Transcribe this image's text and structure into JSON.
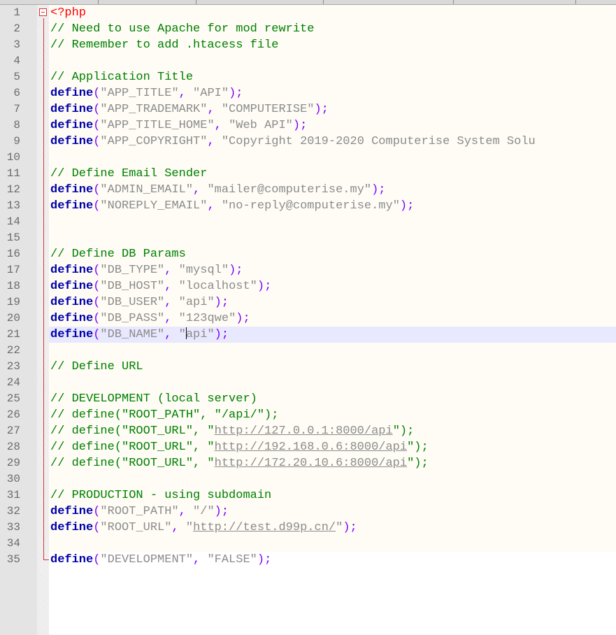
{
  "editor": {
    "language": "PHP",
    "caret_line": 21,
    "lines": [
      {
        "n": "1",
        "tokens": [
          {
            "t": "php",
            "v": "<?php"
          }
        ]
      },
      {
        "n": "2",
        "tokens": [
          {
            "t": "cmt",
            "v": "// Need to use Apache for mod rewrite"
          }
        ]
      },
      {
        "n": "3",
        "tokens": [
          {
            "t": "cmt",
            "v": "// Remember to add .htacess file"
          }
        ]
      },
      {
        "n": "4",
        "tokens": []
      },
      {
        "n": "5",
        "tokens": [
          {
            "t": "cmt",
            "v": "// Application Title"
          }
        ]
      },
      {
        "n": "6",
        "tokens": [
          {
            "t": "kw",
            "v": "define"
          },
          {
            "t": "op",
            "v": "("
          },
          {
            "t": "str",
            "v": "\"APP_TITLE\""
          },
          {
            "t": "op",
            "v": ", "
          },
          {
            "t": "str",
            "v": "\"API\""
          },
          {
            "t": "op",
            "v": ");"
          }
        ]
      },
      {
        "n": "7",
        "tokens": [
          {
            "t": "kw",
            "v": "define"
          },
          {
            "t": "op",
            "v": "("
          },
          {
            "t": "str",
            "v": "\"APP_TRADEMARK\""
          },
          {
            "t": "op",
            "v": ", "
          },
          {
            "t": "str",
            "v": "\"COMPUTERISE\""
          },
          {
            "t": "op",
            "v": ");"
          }
        ]
      },
      {
        "n": "8",
        "tokens": [
          {
            "t": "kw",
            "v": "define"
          },
          {
            "t": "op",
            "v": "("
          },
          {
            "t": "str",
            "v": "\"APP_TITLE_HOME\""
          },
          {
            "t": "op",
            "v": ", "
          },
          {
            "t": "str",
            "v": "\"Web API\""
          },
          {
            "t": "op",
            "v": ");"
          }
        ]
      },
      {
        "n": "9",
        "tokens": [
          {
            "t": "kw",
            "v": "define"
          },
          {
            "t": "op",
            "v": "("
          },
          {
            "t": "str",
            "v": "\"APP_COPYRIGHT\""
          },
          {
            "t": "op",
            "v": ", "
          },
          {
            "t": "str",
            "v": "\"Copyright 2019-2020 Computerise System Solu"
          }
        ]
      },
      {
        "n": "10",
        "tokens": []
      },
      {
        "n": "11",
        "tokens": [
          {
            "t": "cmt",
            "v": "// Define Email Sender"
          }
        ]
      },
      {
        "n": "12",
        "tokens": [
          {
            "t": "kw",
            "v": "define"
          },
          {
            "t": "op",
            "v": "("
          },
          {
            "t": "str",
            "v": "\"ADMIN_EMAIL\""
          },
          {
            "t": "op",
            "v": ", "
          },
          {
            "t": "str",
            "v": "\"mailer@computerise.my\""
          },
          {
            "t": "op",
            "v": ");"
          }
        ]
      },
      {
        "n": "13",
        "tokens": [
          {
            "t": "kw",
            "v": "define"
          },
          {
            "t": "op",
            "v": "("
          },
          {
            "t": "str",
            "v": "\"NOREPLY_EMAIL\""
          },
          {
            "t": "op",
            "v": ", "
          },
          {
            "t": "str",
            "v": "\"no-reply@computerise.my\""
          },
          {
            "t": "op",
            "v": ");"
          }
        ]
      },
      {
        "n": "14",
        "tokens": []
      },
      {
        "n": "15",
        "tokens": []
      },
      {
        "n": "16",
        "tokens": [
          {
            "t": "cmt",
            "v": "// Define DB Params"
          }
        ]
      },
      {
        "n": "17",
        "tokens": [
          {
            "t": "kw",
            "v": "define"
          },
          {
            "t": "op",
            "v": "("
          },
          {
            "t": "str",
            "v": "\"DB_TYPE\""
          },
          {
            "t": "op",
            "v": ", "
          },
          {
            "t": "str",
            "v": "\"mysql\""
          },
          {
            "t": "op",
            "v": ");"
          }
        ]
      },
      {
        "n": "18",
        "tokens": [
          {
            "t": "kw",
            "v": "define"
          },
          {
            "t": "op",
            "v": "("
          },
          {
            "t": "str",
            "v": "\"DB_HOST\""
          },
          {
            "t": "op",
            "v": ", "
          },
          {
            "t": "str",
            "v": "\"localhost\""
          },
          {
            "t": "op",
            "v": ");"
          }
        ]
      },
      {
        "n": "19",
        "tokens": [
          {
            "t": "kw",
            "v": "define"
          },
          {
            "t": "op",
            "v": "("
          },
          {
            "t": "str",
            "v": "\"DB_USER\""
          },
          {
            "t": "op",
            "v": ", "
          },
          {
            "t": "str",
            "v": "\"api\""
          },
          {
            "t": "op",
            "v": ");"
          }
        ]
      },
      {
        "n": "20",
        "tokens": [
          {
            "t": "kw",
            "v": "define"
          },
          {
            "t": "op",
            "v": "("
          },
          {
            "t": "str",
            "v": "\"DB_PASS\""
          },
          {
            "t": "op",
            "v": ", "
          },
          {
            "t": "str",
            "v": "\"123qwe\""
          },
          {
            "t": "op",
            "v": ");"
          }
        ]
      },
      {
        "n": "21",
        "tokens": [
          {
            "t": "kw",
            "v": "define"
          },
          {
            "t": "op",
            "v": "("
          },
          {
            "t": "str",
            "v": "\"DB_NAME\""
          },
          {
            "t": "op",
            "v": ", "
          },
          {
            "t": "str",
            "v": "\""
          },
          {
            "t": "caret",
            "v": ""
          },
          {
            "t": "str",
            "v": "api\""
          },
          {
            "t": "op",
            "v": ");"
          }
        ]
      },
      {
        "n": "22",
        "tokens": []
      },
      {
        "n": "23",
        "tokens": [
          {
            "t": "cmt",
            "v": "// Define URL"
          }
        ]
      },
      {
        "n": "24",
        "tokens": []
      },
      {
        "n": "25",
        "tokens": [
          {
            "t": "cmt",
            "v": "// DEVELOPMENT (local server)"
          }
        ]
      },
      {
        "n": "26",
        "tokens": [
          {
            "t": "cmt",
            "v": "// define(\"ROOT_PATH\", \"/api/\");"
          }
        ]
      },
      {
        "n": "27",
        "tokens": [
          {
            "t": "cmt",
            "v": "// define(\"ROOT_URL\", \""
          },
          {
            "t": "url",
            "v": "http://127.0.0.1:8000/api"
          },
          {
            "t": "cmt",
            "v": "\");"
          }
        ]
      },
      {
        "n": "28",
        "tokens": [
          {
            "t": "cmt",
            "v": "// define(\"ROOT_URL\", \""
          },
          {
            "t": "url",
            "v": "http://192.168.0.6:8000/api"
          },
          {
            "t": "cmt",
            "v": "\");"
          }
        ]
      },
      {
        "n": "29",
        "tokens": [
          {
            "t": "cmt",
            "v": "// define(\"ROOT_URL\", \""
          },
          {
            "t": "url",
            "v": "http://172.20.10.6:8000/api"
          },
          {
            "t": "cmt",
            "v": "\");"
          }
        ]
      },
      {
        "n": "30",
        "tokens": []
      },
      {
        "n": "31",
        "tokens": [
          {
            "t": "cmt",
            "v": "// PRODUCTION - using subdomain"
          }
        ]
      },
      {
        "n": "32",
        "tokens": [
          {
            "t": "kw",
            "v": "define"
          },
          {
            "t": "op",
            "v": "("
          },
          {
            "t": "str",
            "v": "\"ROOT_PATH\""
          },
          {
            "t": "op",
            "v": ", "
          },
          {
            "t": "str",
            "v": "\"/\""
          },
          {
            "t": "op",
            "v": ");"
          }
        ]
      },
      {
        "n": "33",
        "tokens": [
          {
            "t": "kw",
            "v": "define"
          },
          {
            "t": "op",
            "v": "("
          },
          {
            "t": "str",
            "v": "\"ROOT_URL\""
          },
          {
            "t": "op",
            "v": ", "
          },
          {
            "t": "str",
            "v": "\""
          },
          {
            "t": "url",
            "v": "http://test.d99p.cn/"
          },
          {
            "t": "str",
            "v": "\""
          },
          {
            "t": "op",
            "v": ");"
          }
        ]
      },
      {
        "n": "34",
        "tokens": []
      },
      {
        "n": "35",
        "tokens": [
          {
            "t": "kw",
            "v": "define"
          },
          {
            "t": "op",
            "v": "("
          },
          {
            "t": "str",
            "v": "\"DEVELOPMENT\""
          },
          {
            "t": "op",
            "v": ", "
          },
          {
            "t": "str",
            "v": "\"FALSE\""
          },
          {
            "t": "op",
            "v": ");"
          }
        ]
      }
    ]
  }
}
